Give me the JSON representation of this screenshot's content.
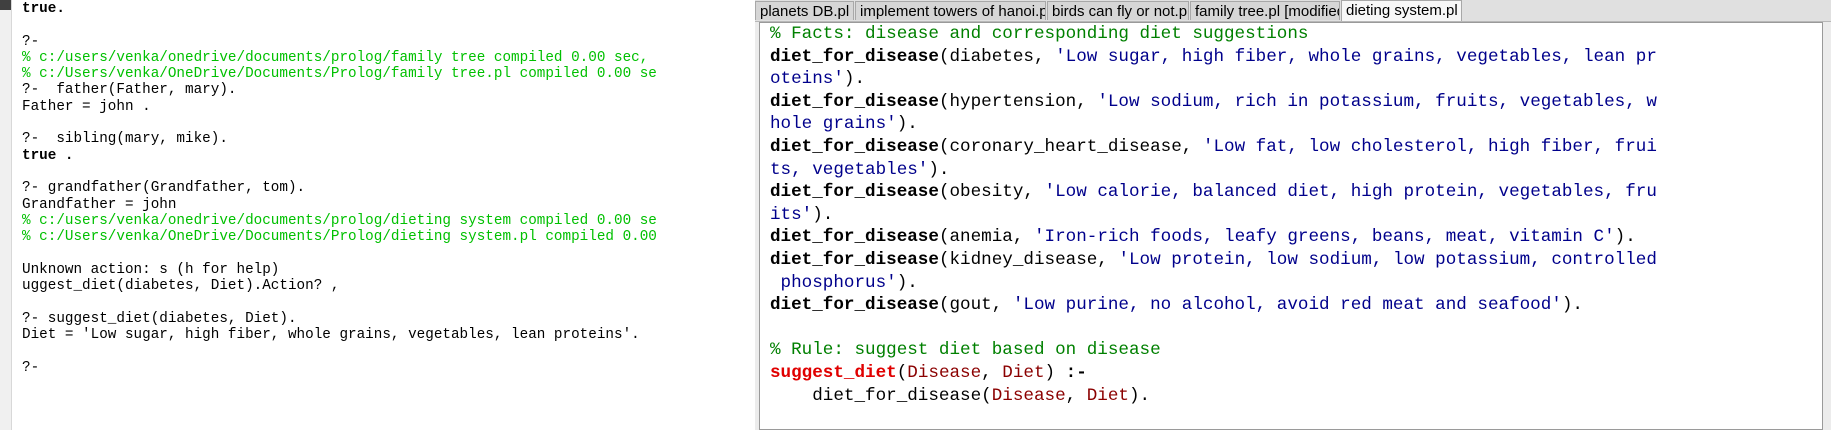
{
  "console": {
    "lines": [
      {
        "text": "true.",
        "style": "bold"
      },
      {
        "text": "",
        "style": ""
      },
      {
        "text": "?-",
        "style": ""
      },
      {
        "text": "% c:/users/venka/onedrive/documents/prolog/family tree compiled 0.00 sec,",
        "style": "green"
      },
      {
        "text": "% c:/Users/venka/OneDrive/Documents/Prolog/family tree.pl compiled 0.00 se",
        "style": "green"
      },
      {
        "text": "?-  father(Father, mary).",
        "style": ""
      },
      {
        "text": "Father = john .",
        "style": ""
      },
      {
        "text": "",
        "style": ""
      },
      {
        "text": "?-  sibling(mary, mike).",
        "style": ""
      },
      {
        "text": "true .",
        "style": "bold"
      },
      {
        "text": "",
        "style": ""
      },
      {
        "text": "?- grandfather(Grandfather, tom).",
        "style": ""
      },
      {
        "text": "Grandfather = john",
        "style": ""
      },
      {
        "text": "% c:/users/venka/onedrive/documents/prolog/dieting system compiled 0.00 se",
        "style": "green"
      },
      {
        "text": "% c:/Users/venka/OneDrive/Documents/Prolog/dieting system.pl compiled 0.00",
        "style": "green"
      },
      {
        "text": "",
        "style": ""
      },
      {
        "text": "Unknown action: s (h for help)",
        "style": ""
      },
      {
        "text": "uggest_diet(diabetes, Diet).Action? ,",
        "style": ""
      },
      {
        "text": "",
        "style": ""
      },
      {
        "text": "?- suggest_diet(diabetes, Diet).",
        "style": ""
      },
      {
        "text": "Diet = 'Low sugar, high fiber, whole grains, vegetables, lean proteins'.",
        "style": ""
      },
      {
        "text": "",
        "style": ""
      },
      {
        "text": "?-",
        "style": ""
      }
    ]
  },
  "tabs": [
    {
      "label": "planets DB.pl",
      "active": false
    },
    {
      "label": "implement towers of hanoi.pl",
      "active": false
    },
    {
      "label": "birds can fly or not.pl",
      "active": false
    },
    {
      "label": "family tree.pl [modified]",
      "active": false
    },
    {
      "label": "dieting system.pl",
      "active": true
    }
  ],
  "code": {
    "lines": [
      [
        {
          "t": "% Facts: disease and corresponding diet suggestions",
          "c": "comment"
        }
      ],
      [
        {
          "t": "diet_for_disease",
          "c": "pred"
        },
        {
          "t": "(diabetes, ",
          "c": "atom"
        },
        {
          "t": "'Low sugar, high fiber, whole grains, vegetables, lean pr",
          "c": "str"
        }
      ],
      [
        {
          "t": "oteins'",
          "c": "str"
        },
        {
          "t": ").",
          "c": "atom"
        }
      ],
      [
        {
          "t": "diet_for_disease",
          "c": "pred"
        },
        {
          "t": "(hypertension, ",
          "c": "atom"
        },
        {
          "t": "'Low sodium, rich in potassium, fruits, vegetables, w",
          "c": "str"
        }
      ],
      [
        {
          "t": "hole grains'",
          "c": "str"
        },
        {
          "t": ").",
          "c": "atom"
        }
      ],
      [
        {
          "t": "diet_for_disease",
          "c": "pred"
        },
        {
          "t": "(coronary_heart_disease, ",
          "c": "atom"
        },
        {
          "t": "'Low fat, low cholesterol, high fiber, frui",
          "c": "str"
        }
      ],
      [
        {
          "t": "ts, vegetables'",
          "c": "str"
        },
        {
          "t": ").",
          "c": "atom"
        }
      ],
      [
        {
          "t": "diet_for_disease",
          "c": "pred"
        },
        {
          "t": "(obesity, ",
          "c": "atom"
        },
        {
          "t": "'Low calorie, balanced diet, high protein, vegetables, fru",
          "c": "str"
        }
      ],
      [
        {
          "t": "its'",
          "c": "str"
        },
        {
          "t": ").",
          "c": "atom"
        }
      ],
      [
        {
          "t": "diet_for_disease",
          "c": "pred"
        },
        {
          "t": "(anemia, ",
          "c": "atom"
        },
        {
          "t": "'Iron-rich foods, leafy greens, beans, meat, vitamin C'",
          "c": "str"
        },
        {
          "t": ").",
          "c": "atom"
        }
      ],
      [
        {
          "t": "diet_for_disease",
          "c": "pred"
        },
        {
          "t": "(kidney_disease, ",
          "c": "atom"
        },
        {
          "t": "'Low protein, low sodium, low potassium, controlled",
          "c": "str"
        }
      ],
      [
        {
          "t": " phosphorus'",
          "c": "str"
        },
        {
          "t": ").",
          "c": "atom"
        }
      ],
      [
        {
          "t": "diet_for_disease",
          "c": "pred"
        },
        {
          "t": "(gout, ",
          "c": "atom"
        },
        {
          "t": "'Low purine, no alcohol, avoid red meat and seafood'",
          "c": "str"
        },
        {
          "t": ").",
          "c": "atom"
        }
      ],
      [],
      [
        {
          "t": "% Rule: suggest diet based on disease",
          "c": "comment"
        }
      ],
      [
        {
          "t": "suggest_diet",
          "c": "head"
        },
        {
          "t": "(",
          "c": "atom"
        },
        {
          "t": "Disease",
          "c": "var"
        },
        {
          "t": ", ",
          "c": "atom"
        },
        {
          "t": "Diet",
          "c": "var"
        },
        {
          "t": ") ",
          "c": "atom"
        },
        {
          "t": ":-",
          "c": "neck"
        }
      ],
      [
        {
          "t": "    diet_for_disease(",
          "c": "atom"
        },
        {
          "t": "Disease",
          "c": "var"
        },
        {
          "t": ", ",
          "c": "atom"
        },
        {
          "t": "Diet",
          "c": "var"
        },
        {
          "t": ").",
          "c": "atom"
        }
      ]
    ]
  }
}
